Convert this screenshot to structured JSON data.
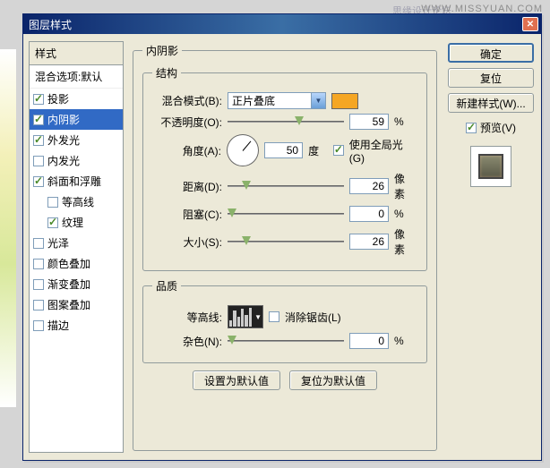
{
  "watermark": "WWW.MISSYUAN.COM",
  "watermark2": "思缘设计论坛",
  "dialog_title": "图层样式",
  "styles": {
    "header": "样式",
    "blending_options": "混合选项:默认",
    "items": [
      {
        "label": "投影",
        "checked": true,
        "selected": false
      },
      {
        "label": "内阴影",
        "checked": true,
        "selected": true
      },
      {
        "label": "外发光",
        "checked": true,
        "selected": false
      },
      {
        "label": "内发光",
        "checked": false,
        "selected": false
      },
      {
        "label": "斜面和浮雕",
        "checked": true,
        "selected": false
      },
      {
        "label": "等高线",
        "checked": false,
        "selected": false,
        "indent": true
      },
      {
        "label": "纹理",
        "checked": true,
        "selected": false,
        "indent": true
      },
      {
        "label": "光泽",
        "checked": false,
        "selected": false
      },
      {
        "label": "颜色叠加",
        "checked": false,
        "selected": false
      },
      {
        "label": "渐变叠加",
        "checked": false,
        "selected": false
      },
      {
        "label": "图案叠加",
        "checked": false,
        "selected": false
      },
      {
        "label": "描边",
        "checked": false,
        "selected": false
      }
    ]
  },
  "panel_title": "内阴影",
  "structure": {
    "legend": "结构",
    "blend_mode_label": "混合模式(B):",
    "blend_mode_value": "正片叠底",
    "color": "#f5a623",
    "opacity_label": "不透明度(O):",
    "opacity_value": "59",
    "percent": "%",
    "angle_label": "角度(A):",
    "angle_value": "50",
    "degree": "度",
    "global_light_label": "使用全局光(G)",
    "distance_label": "距离(D):",
    "distance_value": "26",
    "px": "像素",
    "spread_label": "阻塞(C):",
    "spread_value": "0",
    "size_label": "大小(S):",
    "size_value": "26"
  },
  "quality": {
    "legend": "品质",
    "contour_label": "等高线:",
    "antialias_label": "消除锯齿(L)",
    "noise_label": "杂色(N):",
    "noise_value": "0"
  },
  "buttons": {
    "make_default": "设置为默认值",
    "reset_default": "复位为默认值"
  },
  "right": {
    "ok": "确定",
    "cancel": "复位",
    "new_style": "新建样式(W)...",
    "preview": "预览(V)"
  }
}
